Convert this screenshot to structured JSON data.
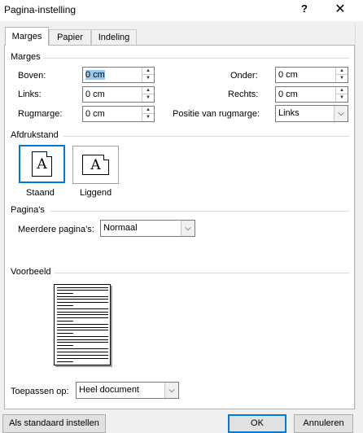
{
  "window": {
    "title": "Pagina-instelling",
    "help_glyph": "?",
    "close_glyph": "✕"
  },
  "tabs": [
    {
      "label": "Marges",
      "active": true
    },
    {
      "label": "Papier",
      "active": false
    },
    {
      "label": "Indeling",
      "active": false
    }
  ],
  "margins": {
    "heading": "Marges",
    "top": {
      "label": "Boven:",
      "value": "0 cm"
    },
    "bottom": {
      "label": "Onder:",
      "value": "0 cm"
    },
    "left": {
      "label": "Links:",
      "value": "0 cm"
    },
    "right": {
      "label": "Rechts:",
      "value": "0 cm"
    },
    "gutter": {
      "label": "Rugmarge:",
      "value": "0 cm"
    },
    "gutter_position": {
      "label": "Positie van rugmarge:",
      "value": "Links"
    }
  },
  "orientation": {
    "heading": "Afdrukstand",
    "portrait": {
      "label": "Staand",
      "glyph": "A",
      "selected": true
    },
    "landscape": {
      "label": "Liggend",
      "glyph": "A",
      "selected": false
    }
  },
  "pages": {
    "heading": "Pagina's",
    "multiple_label": "Meerdere pagina's:",
    "multiple_value": "Normaal"
  },
  "preview": {
    "heading": "Voorbeeld"
  },
  "apply": {
    "label": "Toepassen op:",
    "value": "Heel document"
  },
  "buttons": {
    "set_default": "Als standaard instellen",
    "ok": "OK",
    "cancel": "Annuleren"
  },
  "colors": {
    "accent": "#0078d7",
    "selection": "#99c9ef"
  }
}
